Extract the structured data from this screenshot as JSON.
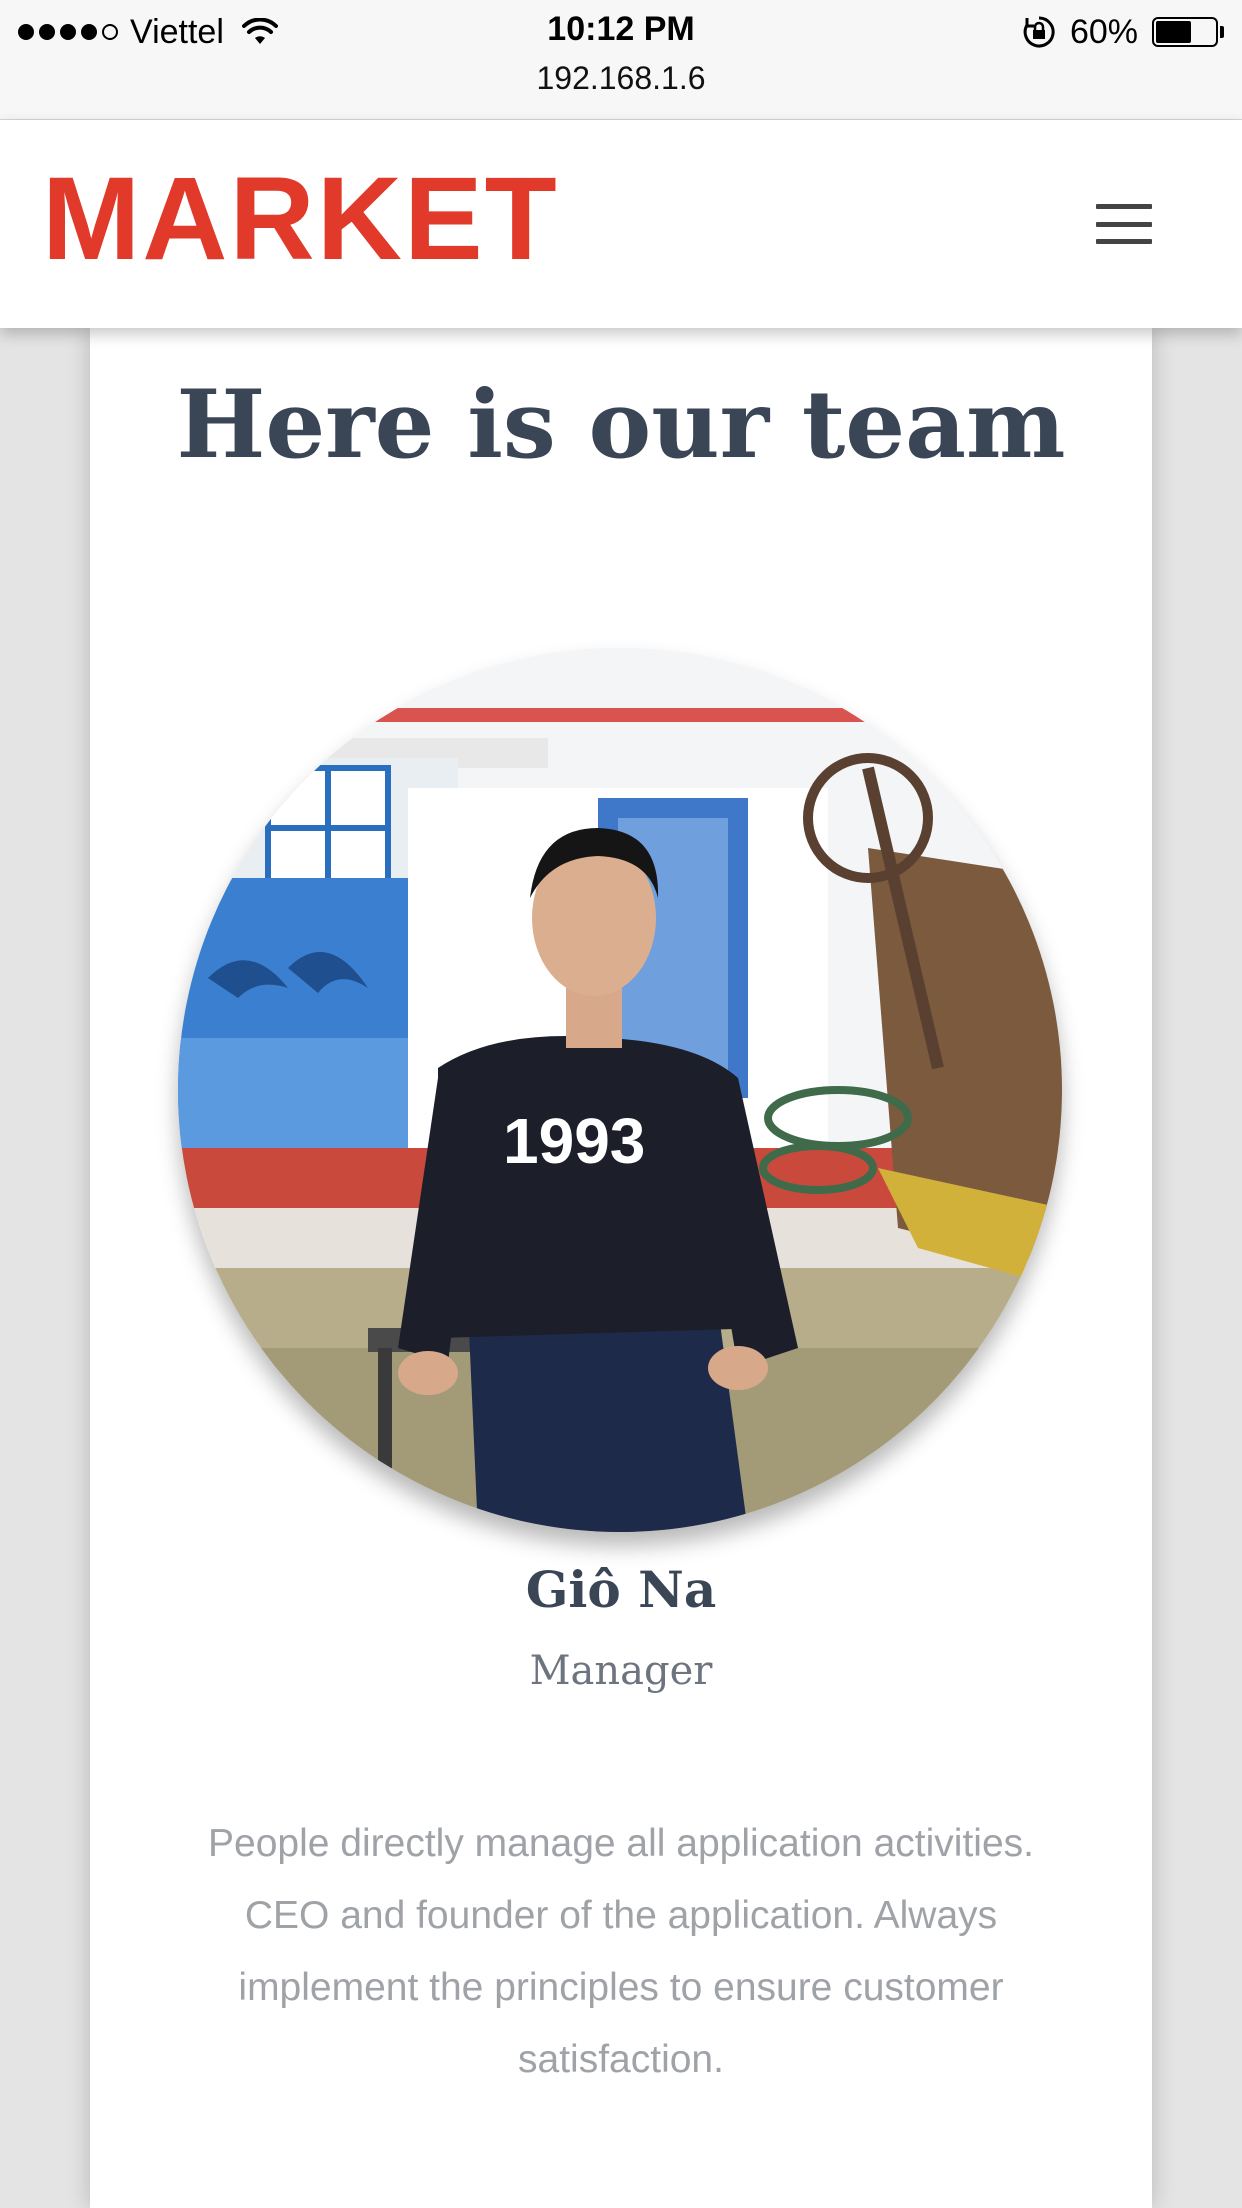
{
  "status_bar": {
    "carrier": "Viettel",
    "time": "10:12 PM",
    "url": "192.168.1.6",
    "battery": "60%",
    "battery_level": 0.6
  },
  "header": {
    "logo": "MARKET",
    "brand_color": "#e13a2b",
    "menu_icon": "hamburger-icon"
  },
  "team": {
    "title": "Here is our team",
    "members": [
      {
        "name": "Giô Na",
        "role": "Manager",
        "description": "People directly manage all application activities. CEO and founder of the application. Always implement the principles to ensure customer satisfaction.",
        "shirt_print": "1993"
      }
    ]
  }
}
